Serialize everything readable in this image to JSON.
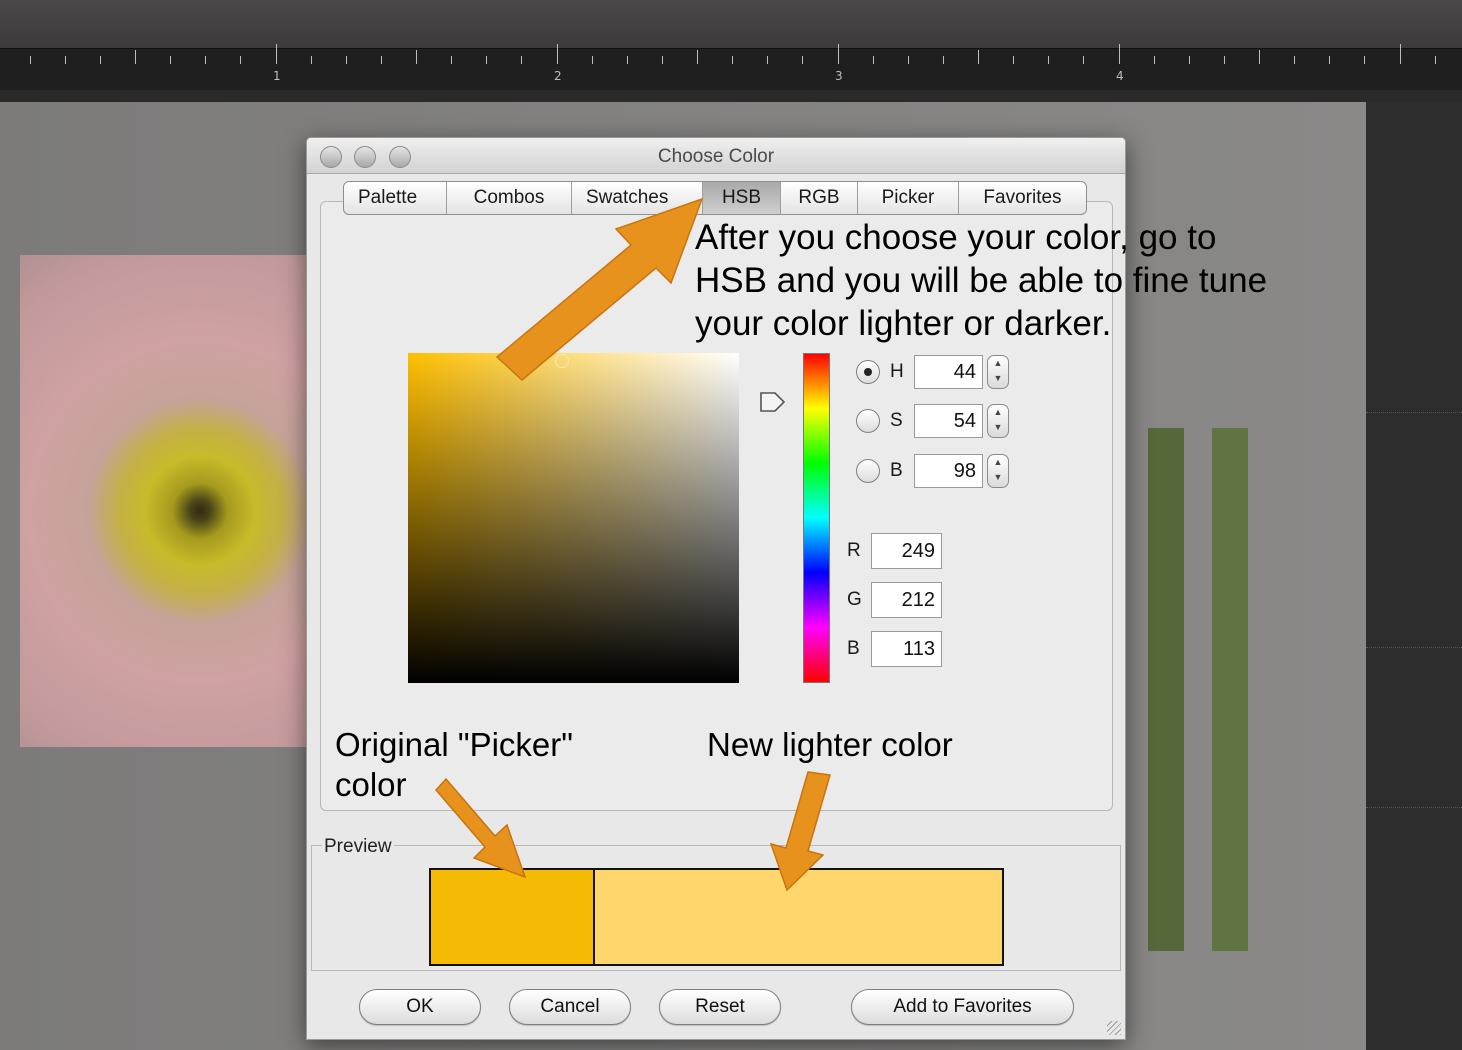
{
  "ruler": {
    "labels": [
      "1",
      "2",
      "3",
      "4"
    ]
  },
  "dialog": {
    "title": "Choose Color",
    "tabs": [
      {
        "label": "Palette",
        "active": false
      },
      {
        "label": "Combos",
        "active": false
      },
      {
        "label": "Swatches",
        "active": false
      },
      {
        "label": "HSB",
        "active": true
      },
      {
        "label": "RGB",
        "active": false
      },
      {
        "label": "Picker",
        "active": false
      },
      {
        "label": "Favorites",
        "active": false
      }
    ],
    "hsb": {
      "h_label": "H",
      "h_value": "44",
      "h_selected": true,
      "s_label": "S",
      "s_value": "54",
      "b_label": "B",
      "b_value": "98"
    },
    "rgb": {
      "r_label": "R",
      "r_value": "249",
      "g_label": "G",
      "g_value": "212",
      "b_label": "B",
      "b_value": "113"
    },
    "preview": {
      "label": "Preview",
      "original_color": "#f5ba04",
      "new_color": "#ffd66b"
    },
    "buttons": {
      "ok": "OK",
      "cancel": "Cancel",
      "reset": "Reset",
      "add_favorites": "Add to Favorites"
    }
  },
  "annotations": {
    "top_note_1": "After you choose your color, go to",
    "top_note_2": "HSB and you will be able to fine tune",
    "top_note_3": "your color lighter or darker.",
    "original_1": "Original \"Picker\"",
    "original_2": "color",
    "new_label": "New lighter color",
    "arrow_color": "#e8921e"
  },
  "colors": {
    "workspace": "#2b2a2a",
    "canvas": "#838281",
    "bar_left": "#56683a",
    "bar_right": "#607443"
  }
}
